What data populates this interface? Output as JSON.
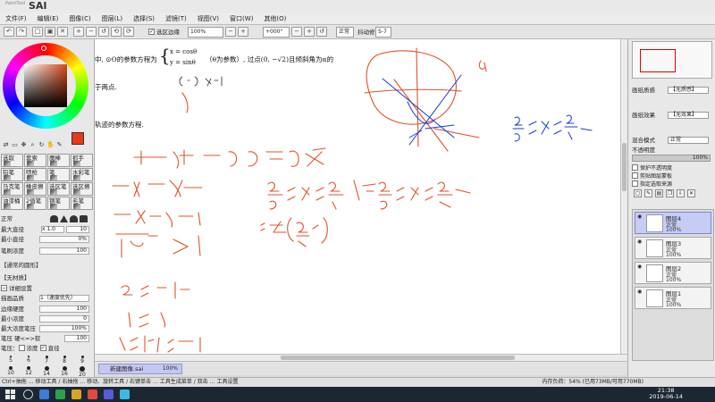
{
  "app": {
    "logo_sub": "PaintTool",
    "logo_main": "SAI"
  },
  "menu": [
    "文件(F)",
    "编辑(E)",
    "图像(C)",
    "图层(L)",
    "选择(S)",
    "滤镜(T)",
    "视图(V)",
    "窗口(W)",
    "其他(O)"
  ],
  "toolbar": {
    "selection_edge_label": "选区边缘",
    "zoom": "100%",
    "rotation": "+000°",
    "mode": "正常",
    "stabilizer_label": "抖动修正",
    "stabilizer_value": "S-7"
  },
  "tools": [
    "选取",
    "套索",
    "魔棒",
    "抓手",
    "铅笔",
    "喷枪",
    "笔",
    "水彩笔",
    "马克笔",
    "橡皮擦",
    "选区笔",
    "选区擦",
    "油漆桶",
    "2值笔",
    "钢笔",
    "毛笔"
  ],
  "brush": {
    "mode": "正常",
    "max_size_label": "最大直径",
    "max_size_value": "x 1.0",
    "max_size_number": "10",
    "min_size_label": "最小直径",
    "min_size_value": "0%",
    "density_label": "笔刷浓度",
    "density_value": "100",
    "shape": "【通常的圆形】",
    "texture": "【无材质】",
    "detail_label": "详细设置",
    "quality_label": "描画品质",
    "quality_value": "1（速度优先）",
    "edge_hardness_label": "边缘硬度",
    "edge_hardness_value": "100",
    "min_density_label": "最小浓度",
    "min_density_value": "0",
    "max_pressure_label": "最大浓度笔压",
    "max_pressure_value": "100%",
    "pressure_label": "笔压 硬<=>软",
    "pressure_value": "100",
    "pressure_opt_label": "笔压：",
    "pressure_density_label": "浓度",
    "pressure_size_label": "直径",
    "size_presets": [
      "5",
      "6",
      "7",
      "8",
      "9",
      "10",
      "12",
      "14",
      "16",
      "20"
    ]
  },
  "canvas_text": {
    "line1_a": "中, ⊙O的参数方程为",
    "line1_x": "x = cosθ",
    "line1_y": "y = sinθ",
    "line1_b": "（θ为参数）, 过点(0, −√2)且倾斜角为α的",
    "line2": "于两点.",
    "line3": "轨迹的参数方程."
  },
  "document": {
    "name": "新建图像.sai",
    "zoom": "100%"
  },
  "right_panel": {
    "paper_texture_label": "画纸质感",
    "paper_texture_value": "【无质感】",
    "paper_effect_label": "画纸效果",
    "paper_effect_value": "【无效果】",
    "blend_label": "混合模式",
    "blend_value": "正常",
    "opacity_label": "不透明度",
    "opacity_value": "100%",
    "protect_alpha": "保护不透明度",
    "clip_group": "剪贴图层蒙板",
    "selection_source": "指定选取来源"
  },
  "layers": [
    {
      "name": "图层4",
      "mode": "正常",
      "opacity": "100%",
      "active": true
    },
    {
      "name": "图层3",
      "mode": "正常",
      "opacity": "100%",
      "active": false
    },
    {
      "name": "图层2",
      "mode": "正常",
      "opacity": "100%",
      "active": false
    },
    {
      "name": "图层1",
      "mode": "正常",
      "opacity": "100%",
      "active": false
    }
  ],
  "status": {
    "left": "Ctrl+抽拖 … 移动工具 / 右抽拖 … 移动、旋转工具 / 右键单击 … 工具生成菜单 / 双击 … 工具设置",
    "right": "内存负荷：54% (已用73MB/可用770MB)"
  },
  "taskbar": {
    "time": "21:38",
    "date": "2019-06-14"
  },
  "colors": {
    "foreground": "#e8391a",
    "background": "#1f3fc8",
    "ink_red": "#e0522a",
    "ink_blue": "#1a3bd0"
  }
}
